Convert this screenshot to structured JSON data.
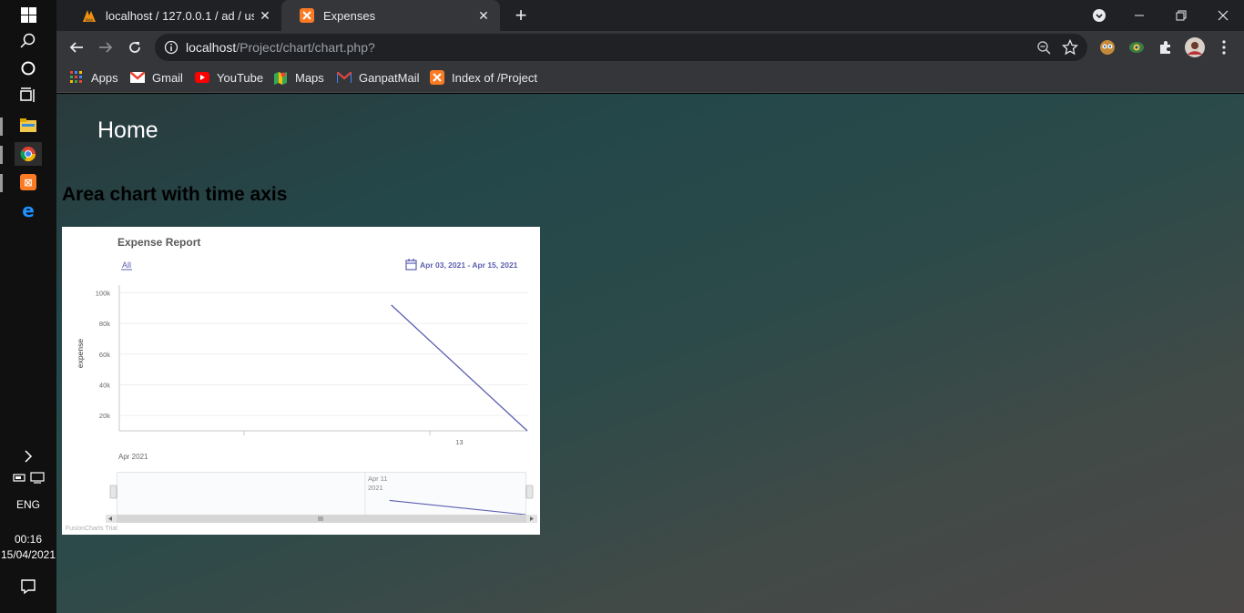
{
  "taskbar": {
    "lang": "ENG",
    "time": "00:16",
    "date": "15/04/2021"
  },
  "browser": {
    "tabs": [
      {
        "title": "localhost / 127.0.0.1 / ad / user_l",
        "icon": "phpmyadmin-icon",
        "active": false
      },
      {
        "title": "Expenses",
        "icon": "xampp-icon",
        "active": true
      }
    ],
    "url_host": "localhost",
    "url_path": "/Project/chart/chart.php?",
    "bookmarks": [
      {
        "label": "Apps",
        "icon": "apps-grid-icon"
      },
      {
        "label": "Gmail",
        "icon": "gmail-icon"
      },
      {
        "label": "YouTube",
        "icon": "youtube-icon"
      },
      {
        "label": "Maps",
        "icon": "maps-icon"
      },
      {
        "label": "GanpatMail",
        "icon": "ganpatmail-icon"
      },
      {
        "label": "Index of /Project",
        "icon": "xampp-icon"
      }
    ],
    "accent": "#35363a"
  },
  "page": {
    "home": "Home",
    "heading": "Area chart with time axis"
  },
  "chart_data": {
    "type": "area",
    "title": "Expense Report",
    "ylabel": "expense",
    "xlabel": "",
    "range_button": "All",
    "date_range": "Apr 03, 2021 - Apr 15, 2021",
    "x_ticks": [
      "13"
    ],
    "x_period_label": "Apr 2021",
    "y_ticks": [
      "20k",
      "40k",
      "60k",
      "80k",
      "100k"
    ],
    "ylim": [
      10000,
      100000
    ],
    "navigator_label_line1": "Apr 11",
    "navigator_label_line2": "2021",
    "series": [
      {
        "x": [
          "2021-04-11",
          "2021-04-15"
        ],
        "values": [
          92000,
          10000
        ],
        "color": "#5b5fb0"
      }
    ],
    "watermark": "FusionCharts Trial",
    "grid": true
  }
}
